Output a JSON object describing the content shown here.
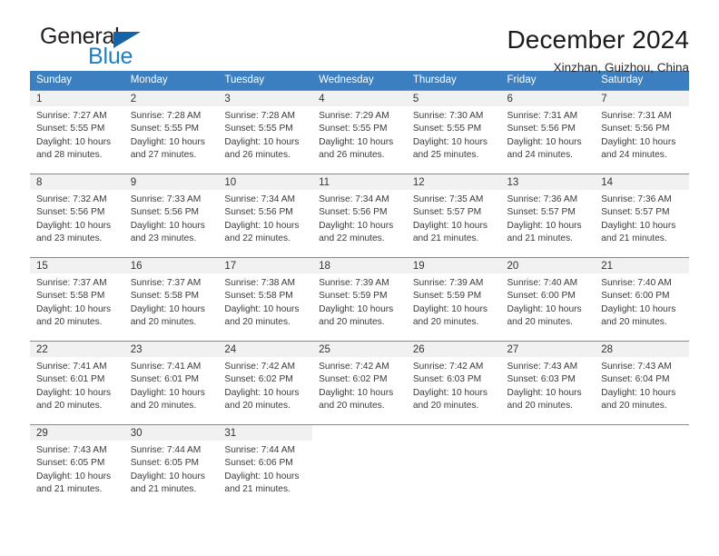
{
  "logo": {
    "word_top": "General",
    "word_bottom": "Blue",
    "icon": "triangle-logo-icon",
    "color_dark": "#231f20",
    "color_blue": "#1f7fc4"
  },
  "header": {
    "title": "December 2024",
    "subtitle": "Xinzhan, Guizhou, China"
  },
  "theme": {
    "header_blue": "#3c7fc0",
    "row_border_blue": "#5b93cd",
    "daynum_bg": "#f1f1f1"
  },
  "weekdays": [
    "Sunday",
    "Monday",
    "Tuesday",
    "Wednesday",
    "Thursday",
    "Friday",
    "Saturday"
  ],
  "weeks": [
    [
      {
        "day": "1",
        "sunrise": "Sunrise: 7:27 AM",
        "sunset": "Sunset: 5:55 PM",
        "daylight1": "Daylight: 10 hours",
        "daylight2": "and 28 minutes."
      },
      {
        "day": "2",
        "sunrise": "Sunrise: 7:28 AM",
        "sunset": "Sunset: 5:55 PM",
        "daylight1": "Daylight: 10 hours",
        "daylight2": "and 27 minutes."
      },
      {
        "day": "3",
        "sunrise": "Sunrise: 7:28 AM",
        "sunset": "Sunset: 5:55 PM",
        "daylight1": "Daylight: 10 hours",
        "daylight2": "and 26 minutes."
      },
      {
        "day": "4",
        "sunrise": "Sunrise: 7:29 AM",
        "sunset": "Sunset: 5:55 PM",
        "daylight1": "Daylight: 10 hours",
        "daylight2": "and 26 minutes."
      },
      {
        "day": "5",
        "sunrise": "Sunrise: 7:30 AM",
        "sunset": "Sunset: 5:55 PM",
        "daylight1": "Daylight: 10 hours",
        "daylight2": "and 25 minutes."
      },
      {
        "day": "6",
        "sunrise": "Sunrise: 7:31 AM",
        "sunset": "Sunset: 5:56 PM",
        "daylight1": "Daylight: 10 hours",
        "daylight2": "and 24 minutes."
      },
      {
        "day": "7",
        "sunrise": "Sunrise: 7:31 AM",
        "sunset": "Sunset: 5:56 PM",
        "daylight1": "Daylight: 10 hours",
        "daylight2": "and 24 minutes."
      }
    ],
    [
      {
        "day": "8",
        "sunrise": "Sunrise: 7:32 AM",
        "sunset": "Sunset: 5:56 PM",
        "daylight1": "Daylight: 10 hours",
        "daylight2": "and 23 minutes."
      },
      {
        "day": "9",
        "sunrise": "Sunrise: 7:33 AM",
        "sunset": "Sunset: 5:56 PM",
        "daylight1": "Daylight: 10 hours",
        "daylight2": "and 23 minutes."
      },
      {
        "day": "10",
        "sunrise": "Sunrise: 7:34 AM",
        "sunset": "Sunset: 5:56 PM",
        "daylight1": "Daylight: 10 hours",
        "daylight2": "and 22 minutes."
      },
      {
        "day": "11",
        "sunrise": "Sunrise: 7:34 AM",
        "sunset": "Sunset: 5:56 PM",
        "daylight1": "Daylight: 10 hours",
        "daylight2": "and 22 minutes."
      },
      {
        "day": "12",
        "sunrise": "Sunrise: 7:35 AM",
        "sunset": "Sunset: 5:57 PM",
        "daylight1": "Daylight: 10 hours",
        "daylight2": "and 21 minutes."
      },
      {
        "day": "13",
        "sunrise": "Sunrise: 7:36 AM",
        "sunset": "Sunset: 5:57 PM",
        "daylight1": "Daylight: 10 hours",
        "daylight2": "and 21 minutes."
      },
      {
        "day": "14",
        "sunrise": "Sunrise: 7:36 AM",
        "sunset": "Sunset: 5:57 PM",
        "daylight1": "Daylight: 10 hours",
        "daylight2": "and 21 minutes."
      }
    ],
    [
      {
        "day": "15",
        "sunrise": "Sunrise: 7:37 AM",
        "sunset": "Sunset: 5:58 PM",
        "daylight1": "Daylight: 10 hours",
        "daylight2": "and 20 minutes."
      },
      {
        "day": "16",
        "sunrise": "Sunrise: 7:37 AM",
        "sunset": "Sunset: 5:58 PM",
        "daylight1": "Daylight: 10 hours",
        "daylight2": "and 20 minutes."
      },
      {
        "day": "17",
        "sunrise": "Sunrise: 7:38 AM",
        "sunset": "Sunset: 5:58 PM",
        "daylight1": "Daylight: 10 hours",
        "daylight2": "and 20 minutes."
      },
      {
        "day": "18",
        "sunrise": "Sunrise: 7:39 AM",
        "sunset": "Sunset: 5:59 PM",
        "daylight1": "Daylight: 10 hours",
        "daylight2": "and 20 minutes."
      },
      {
        "day": "19",
        "sunrise": "Sunrise: 7:39 AM",
        "sunset": "Sunset: 5:59 PM",
        "daylight1": "Daylight: 10 hours",
        "daylight2": "and 20 minutes."
      },
      {
        "day": "20",
        "sunrise": "Sunrise: 7:40 AM",
        "sunset": "Sunset: 6:00 PM",
        "daylight1": "Daylight: 10 hours",
        "daylight2": "and 20 minutes."
      },
      {
        "day": "21",
        "sunrise": "Sunrise: 7:40 AM",
        "sunset": "Sunset: 6:00 PM",
        "daylight1": "Daylight: 10 hours",
        "daylight2": "and 20 minutes."
      }
    ],
    [
      {
        "day": "22",
        "sunrise": "Sunrise: 7:41 AM",
        "sunset": "Sunset: 6:01 PM",
        "daylight1": "Daylight: 10 hours",
        "daylight2": "and 20 minutes."
      },
      {
        "day": "23",
        "sunrise": "Sunrise: 7:41 AM",
        "sunset": "Sunset: 6:01 PM",
        "daylight1": "Daylight: 10 hours",
        "daylight2": "and 20 minutes."
      },
      {
        "day": "24",
        "sunrise": "Sunrise: 7:42 AM",
        "sunset": "Sunset: 6:02 PM",
        "daylight1": "Daylight: 10 hours",
        "daylight2": "and 20 minutes."
      },
      {
        "day": "25",
        "sunrise": "Sunrise: 7:42 AM",
        "sunset": "Sunset: 6:02 PM",
        "daylight1": "Daylight: 10 hours",
        "daylight2": "and 20 minutes."
      },
      {
        "day": "26",
        "sunrise": "Sunrise: 7:42 AM",
        "sunset": "Sunset: 6:03 PM",
        "daylight1": "Daylight: 10 hours",
        "daylight2": "and 20 minutes."
      },
      {
        "day": "27",
        "sunrise": "Sunrise: 7:43 AM",
        "sunset": "Sunset: 6:03 PM",
        "daylight1": "Daylight: 10 hours",
        "daylight2": "and 20 minutes."
      },
      {
        "day": "28",
        "sunrise": "Sunrise: 7:43 AM",
        "sunset": "Sunset: 6:04 PM",
        "daylight1": "Daylight: 10 hours",
        "daylight2": "and 20 minutes."
      }
    ],
    [
      {
        "day": "29",
        "sunrise": "Sunrise: 7:43 AM",
        "sunset": "Sunset: 6:05 PM",
        "daylight1": "Daylight: 10 hours",
        "daylight2": "and 21 minutes."
      },
      {
        "day": "30",
        "sunrise": "Sunrise: 7:44 AM",
        "sunset": "Sunset: 6:05 PM",
        "daylight1": "Daylight: 10 hours",
        "daylight2": "and 21 minutes."
      },
      {
        "day": "31",
        "sunrise": "Sunrise: 7:44 AM",
        "sunset": "Sunset: 6:06 PM",
        "daylight1": "Daylight: 10 hours",
        "daylight2": "and 21 minutes."
      },
      {
        "day": "",
        "sunrise": "",
        "sunset": "",
        "daylight1": "",
        "daylight2": ""
      },
      {
        "day": "",
        "sunrise": "",
        "sunset": "",
        "daylight1": "",
        "daylight2": ""
      },
      {
        "day": "",
        "sunrise": "",
        "sunset": "",
        "daylight1": "",
        "daylight2": ""
      },
      {
        "day": "",
        "sunrise": "",
        "sunset": "",
        "daylight1": "",
        "daylight2": ""
      }
    ]
  ]
}
